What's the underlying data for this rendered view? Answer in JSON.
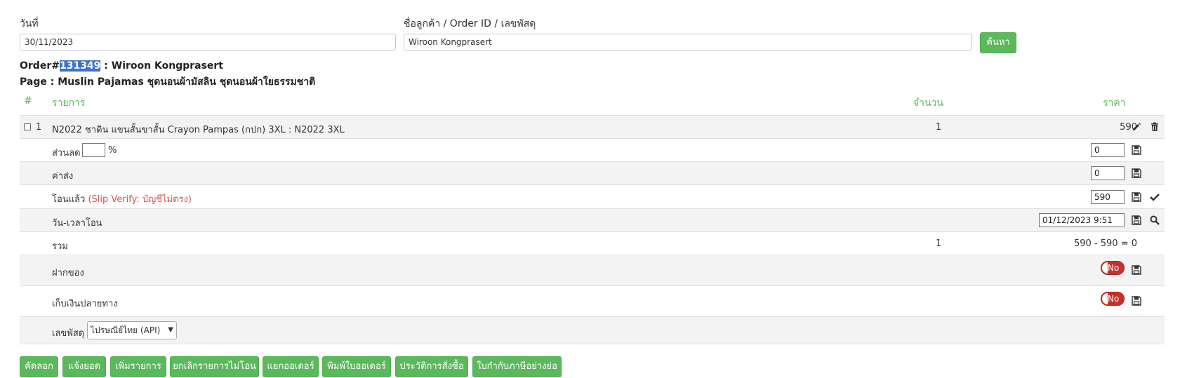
{
  "search": {
    "date_label": "วันที่",
    "date_value": "30/11/2023",
    "customer_label": "ชื่อลูกค้า / Order ID / เลขพัสดุ",
    "customer_value": "Wiroon Kongprasert",
    "search_button": "ค้นหา"
  },
  "order": {
    "prefix": "Order#",
    "number": "131349",
    "customer_suffix": ": Wiroon Kongprasert",
    "page_line": "Page : Muslin Pajamas ชุดนอนผ้ามัสลิน ชุดนอนผ้าใยธรรมชาติ"
  },
  "table": {
    "headers": {
      "index": "#",
      "item": "รายการ",
      "qty": "จำนวน",
      "price": "ราคา"
    },
    "item": {
      "index": "1",
      "name": "N2022 ชาดิน แขนสั้นขาสั้น Crayon Pampas (กปก) 3XL : N2022 3XL",
      "qty": "1",
      "price": "590"
    },
    "discount": {
      "label": "ส่วนลด",
      "percent_value": "",
      "percent_sign": "%",
      "value": "0"
    },
    "shipping": {
      "label": "ค่าส่ง",
      "value": "0"
    },
    "transferred": {
      "label": "โอนแล้ว",
      "note": "(Slip Verify: บัญชีไม่ตรง)",
      "value": "590"
    },
    "transfer_time": {
      "label": "วัน-เวลาโอน",
      "value": "01/12/2023 9:51"
    },
    "total": {
      "label": "รวม",
      "qty": "1",
      "value": "590 - 590 = 0"
    },
    "deposit": {
      "label": "ฝากของ",
      "toggle": "No"
    },
    "cod": {
      "label": "เก็บเงินปลายทาง",
      "toggle": "No"
    },
    "tracking": {
      "label": "เลขพัสดุ",
      "selected": "ไปรษณีย์ไทย (API)"
    }
  },
  "actions": {
    "copy": "คัดลอก",
    "notify": "แจ้งยอด",
    "add_item": "เพิ่มรายการ",
    "cancel_unpaid": "ยกเลิกรายการไม่โอน",
    "split_order": "แยกออเดอร์",
    "print_order": "พิมพ์ใบออเดอร์",
    "history": "ประวัติการสั่งซื้อ",
    "tax_invoice": "ใบกำกับภาษีอย่างย่อ"
  },
  "colors": {
    "accent": "#5cb85c",
    "danger": "#c9302c",
    "highlight": "#3b73c5"
  }
}
